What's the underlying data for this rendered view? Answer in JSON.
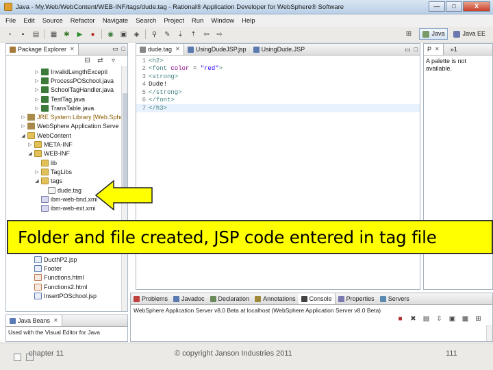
{
  "window": {
    "title": "Java - My.Web/WebContent/WEB-INF/tags/dude.tag - Rational® Application Developer for WebSphere® Software",
    "minimize": "—",
    "maximize": "□",
    "close": "X"
  },
  "menu": [
    "File",
    "Edit",
    "Source",
    "Refactor",
    "Navigate",
    "Search",
    "Project",
    "Run",
    "Window",
    "Help"
  ],
  "perspectives": {
    "java": "Java",
    "javaee": "Java EE"
  },
  "explorer": {
    "tab": "Package Explorer",
    "items": [
      {
        "label": "InvalidLengthExcepti",
        "icon": "java",
        "indent": 4,
        "tw": "▷"
      },
      {
        "label": "ProcessPOSchool.java",
        "icon": "java",
        "indent": 4,
        "tw": "▷"
      },
      {
        "label": "SchoolTagHandler.java",
        "icon": "java",
        "indent": 4,
        "tw": "▷"
      },
      {
        "label": "TestTag.java",
        "icon": "java",
        "indent": 4,
        "tw": "▷"
      },
      {
        "label": "TransTable.java",
        "icon": "java",
        "indent": 4,
        "tw": "▷"
      },
      {
        "label": "JRE System Library [Web.Sphe",
        "icon": "lib",
        "indent": 2,
        "tw": "▷",
        "hl": "hl"
      },
      {
        "label": "WebSphere Application Serve",
        "icon": "lib",
        "indent": 2,
        "tw": "▷"
      },
      {
        "label": "WebContent",
        "icon": "folder",
        "indent": 2,
        "tw": "◢"
      },
      {
        "label": "META-INF",
        "icon": "folder",
        "indent": 3,
        "tw": "▷"
      },
      {
        "label": "WEB-INF",
        "icon": "folder",
        "indent": 3,
        "tw": "◢"
      },
      {
        "label": "lib",
        "icon": "folder",
        "indent": 4,
        "tw": ""
      },
      {
        "label": "TagLibs",
        "icon": "folder",
        "indent": 4,
        "tw": "▷"
      },
      {
        "label": "tags",
        "icon": "folder",
        "indent": 4,
        "tw": "◢"
      },
      {
        "label": "dude.tag",
        "icon": "file",
        "indent": 5,
        "tw": ""
      },
      {
        "label": "ibm-web-bnd.xmi",
        "icon": "xml",
        "indent": 4,
        "tw": ""
      },
      {
        "label": "ibm-web-ext.xmi",
        "icon": "xml",
        "indent": 4,
        "tw": ""
      }
    ],
    "items_lower": [
      {
        "label": "DucthP2.jsp",
        "icon": "jsp",
        "indent": 3,
        "tw": ""
      },
      {
        "label": "Footer",
        "icon": "jsp",
        "indent": 3,
        "tw": ""
      },
      {
        "label": "Functions.html",
        "icon": "html",
        "indent": 3,
        "tw": ""
      },
      {
        "label": "Functions2.html",
        "icon": "html",
        "indent": 3,
        "tw": ""
      },
      {
        "label": "InsertPOSchool.jsp",
        "icon": "jsp",
        "indent": 3,
        "tw": ""
      }
    ]
  },
  "editor": {
    "tabs": [
      "dude.tag",
      "UsingDudeJSP.jsp",
      "UsingDude.JSP"
    ],
    "overflow": "»2",
    "lines": [
      {
        "n": "1",
        "html": "<span class='tagc'>&lt;h2&gt;</span>"
      },
      {
        "n": "2",
        "html": "<span class='tagc'>&lt;font </span><span class='attr'>color</span> = <span class='str'>\"red\"</span><span class='tagc'>&gt;</span>"
      },
      {
        "n": "3",
        "html": "<span class='tagc'>&lt;strong&gt;</span>"
      },
      {
        "n": "4",
        "html": "Dude!"
      },
      {
        "n": "5",
        "html": "<span class='tagc'>&lt;/strong&gt;</span>"
      },
      {
        "n": "6",
        "html": "<span class='tagc'>&lt;/font&gt;</span>"
      },
      {
        "n": "7",
        "html": "<span class='tagc'>&lt;/h3&gt;</span>"
      }
    ]
  },
  "palette": {
    "tab": "P",
    "overflow": "»1",
    "message": "A palette is not available."
  },
  "bottom": {
    "tabs": [
      "Problems",
      "Javadoc",
      "Declaration",
      "Annotations",
      "Console",
      "Properties",
      "Servers"
    ],
    "console_line": "WebSphere Application Server v8.0 Beta at localhost (WebSphere Application Server v8.0 Beta)"
  },
  "javabeans": {
    "tab": "Java Beans",
    "message": "Used with the Visual Editor for Java"
  },
  "banner": "Folder and file created, JSP code entered in tag file",
  "footer": {
    "left": "chapter 11",
    "mid": "© copyright Janson Industries 2011",
    "right": "111"
  },
  "colors": {
    "banner": "#ffff00",
    "arrow": "#ffff00"
  }
}
